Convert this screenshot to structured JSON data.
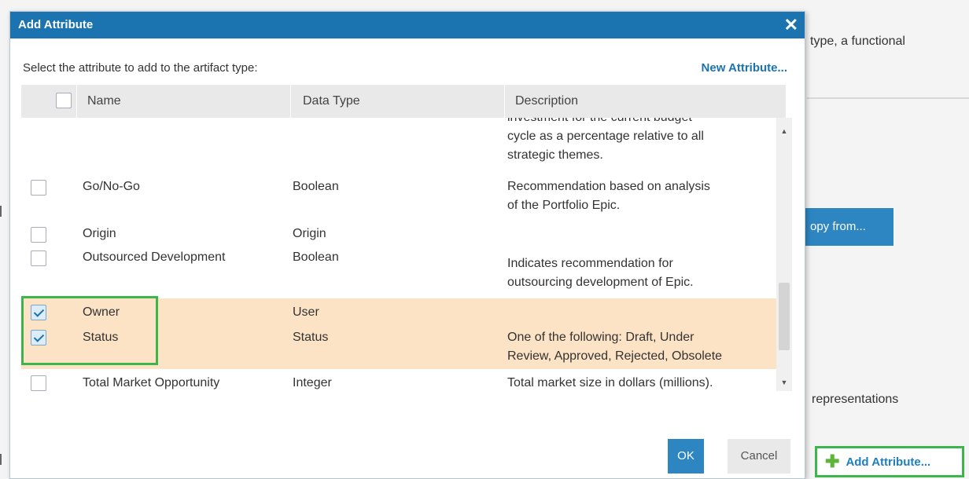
{
  "background": {
    "text_top": "type, a functional",
    "copy_button": "opy from...",
    "text_representations": "representations",
    "add_attribute_button": "Add Attribute..."
  },
  "dialog": {
    "title": "Add Attribute",
    "close_icon": "close-icon",
    "prompt": "Select the attribute to add to the artifact type:",
    "new_attribute_link": "New Attribute...",
    "columns": [
      "Name",
      "Data Type",
      "Description"
    ],
    "rows": [
      {
        "checked": false,
        "name": "",
        "type": "",
        "desc": [
          "investment for the current budget",
          "cycle as a percentage relative to all",
          "strategic themes."
        ],
        "partial": true
      },
      {
        "checked": false,
        "name": "Go/No-Go",
        "type": "Boolean",
        "desc": [
          "Recommendation based on analysis",
          "of the Portfolio Epic."
        ]
      },
      {
        "checked": false,
        "name": "Origin",
        "type": "Origin",
        "desc": []
      },
      {
        "checked": false,
        "name": "Outsourced Development",
        "type": "Boolean",
        "desc": [
          "Indicates recommendation for",
          "outsourcing development of Epic."
        ]
      },
      {
        "checked": true,
        "name": "Owner",
        "type": "User",
        "desc": []
      },
      {
        "checked": true,
        "name": "Status",
        "type": "Status",
        "desc": [
          "One of the following: Draft, Under",
          "Review, Approved, Rejected, Obsolete"
        ]
      },
      {
        "checked": false,
        "name": "Total Market Opportunity",
        "type": "Integer",
        "desc": [
          "Total market size in dollars (millions)."
        ]
      }
    ],
    "ok_label": "OK",
    "cancel_label": "Cancel"
  },
  "colors": {
    "titlebar": "#1b73b0",
    "selected_row": "#fde3c5",
    "highlight": "#3cb64a",
    "primary_button": "#2d86c2"
  }
}
